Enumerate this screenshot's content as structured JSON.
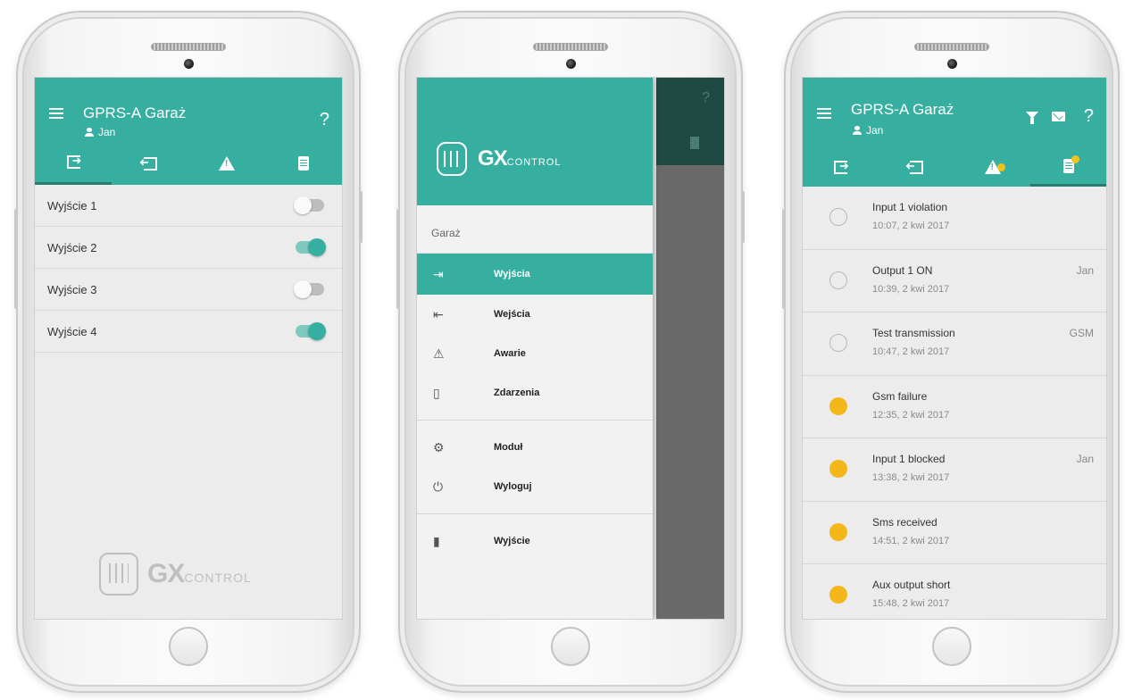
{
  "app": {
    "title": "GPRS-A Garaż",
    "user": "Jan",
    "help_label": "?",
    "accent_color": "#36afa0",
    "alert_color": "#f4b719"
  },
  "tabs": [
    {
      "icon": "exit-icon"
    },
    {
      "icon": "entry-icon"
    },
    {
      "icon": "warning-icon"
    },
    {
      "icon": "log-icon"
    }
  ],
  "outputs": [
    {
      "label": "Wyjście 1",
      "state": "off"
    },
    {
      "label": "Wyjście 2",
      "state": "on"
    },
    {
      "label": "Wyjście 3",
      "state": "off"
    },
    {
      "label": "Wyjście 4",
      "state": "on"
    }
  ],
  "logo": {
    "gx": "GX",
    "control": "CONTROL"
  },
  "drawer": {
    "section": "Garaż",
    "items": [
      {
        "label": "Wyjścia",
        "icon": "exit-icon",
        "active": true
      },
      {
        "label": "Wejścia",
        "icon": "entry-icon",
        "active": false
      },
      {
        "label": "Awarie",
        "icon": "warning-icon",
        "active": false
      },
      {
        "label": "Zdarzenia",
        "icon": "log-icon",
        "active": false
      },
      {
        "label": "Moduł",
        "icon": "module-icon",
        "active": false
      },
      {
        "label": "Wyloguj",
        "icon": "power-icon",
        "active": false
      },
      {
        "label": "Wyjście",
        "icon": "door-icon",
        "active": false
      }
    ]
  },
  "events": [
    {
      "title": "Input 1 violation",
      "time": "10:07, 2 kwi 2017",
      "source": "",
      "status": "normal"
    },
    {
      "title": "Output 1 ON",
      "time": "10:39, 2 kwi 2017",
      "source": "Jan",
      "status": "normal"
    },
    {
      "title": "Test transmission",
      "time": "10:47, 2 kwi 2017",
      "source": "GSM",
      "status": "normal"
    },
    {
      "title": "Gsm failure",
      "time": "12:35, 2 kwi 2017",
      "source": "",
      "status": "alert"
    },
    {
      "title": "Input 1 blocked",
      "time": "13:38, 2 kwi 2017",
      "source": "Jan",
      "status": "alert"
    },
    {
      "title": "Sms received",
      "time": "14:51, 2 kwi 2017",
      "source": "",
      "status": "alert"
    },
    {
      "title": "Aux output short",
      "time": "15:48, 2 kwi 2017",
      "source": "",
      "status": "alert"
    }
  ]
}
